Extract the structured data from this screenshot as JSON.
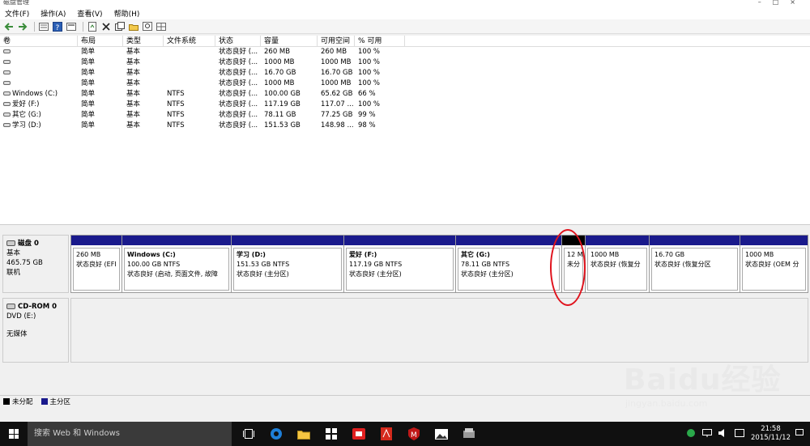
{
  "window": {
    "title": "磁盘管理"
  },
  "menu": [
    "文件(F)",
    "操作(A)",
    "查看(V)",
    "帮助(H)"
  ],
  "toolbar_icons": [
    "back-arrow-icon",
    "forward-arrow-icon",
    "list-icon",
    "help-icon",
    "properties-icon",
    "refresh-icon",
    "delete-icon",
    "copy-icon",
    "open-icon",
    "search-icon",
    "grid-icon"
  ],
  "volume_table": {
    "headers": [
      "卷",
      "布局",
      "类型",
      "文件系统",
      "状态",
      "容量",
      "可用空间",
      "% 可用"
    ],
    "rows": [
      [
        "",
        "简单",
        "基本",
        "",
        "状态良好 (...",
        "260 MB",
        "260 MB",
        "100 %"
      ],
      [
        "",
        "简单",
        "基本",
        "",
        "状态良好 (...",
        "1000 MB",
        "1000 MB",
        "100 %"
      ],
      [
        "",
        "简单",
        "基本",
        "",
        "状态良好 (...",
        "16.70 GB",
        "16.70 GB",
        "100 %"
      ],
      [
        "",
        "简单",
        "基本",
        "",
        "状态良好 (...",
        "1000 MB",
        "1000 MB",
        "100 %"
      ],
      [
        "Windows (C:)",
        "简单",
        "基本",
        "NTFS",
        "状态良好 (...",
        "100.00 GB",
        "65.62 GB",
        "66 %"
      ],
      [
        "爱好 (F:)",
        "简单",
        "基本",
        "NTFS",
        "状态良好 (...",
        "117.19 GB",
        "117.07 ...",
        "100 %"
      ],
      [
        "其它 (G:)",
        "简单",
        "基本",
        "NTFS",
        "状态良好 (...",
        "78.11 GB",
        "77.25 GB",
        "99 %"
      ],
      [
        "学习 (D:)",
        "简单",
        "基本",
        "NTFS",
        "状态良好 (...",
        "151.53 GB",
        "148.98 ...",
        "98 %"
      ]
    ]
  },
  "disk0": {
    "name": "磁盘 0",
    "type": "基本",
    "size": "465.75 GB",
    "status": "联机",
    "partitions": [
      {
        "name": "",
        "size": "260 MB",
        "status": "状态良好 (EFI",
        "kind": "primary"
      },
      {
        "name": "Windows  (C:)",
        "size": "100.00 GB NTFS",
        "status": "状态良好 (启动, 页面文件, 故障",
        "kind": "primary"
      },
      {
        "name": "学习  (D:)",
        "size": "151.53 GB NTFS",
        "status": "状态良好 (主分区)",
        "kind": "primary"
      },
      {
        "name": "爱好  (F:)",
        "size": "117.19 GB NTFS",
        "status": "状态良好 (主分区)",
        "kind": "primary"
      },
      {
        "name": "其它  (G:)",
        "size": "78.11 GB NTFS",
        "status": "状态良好 (主分区)",
        "kind": "primary"
      },
      {
        "name": "",
        "size": "12 M",
        "status": "未分",
        "kind": "unallocated"
      },
      {
        "name": "",
        "size": "1000 MB",
        "status": "状态良好 (恢复分",
        "kind": "primary"
      },
      {
        "name": "",
        "size": "16.70 GB",
        "status": "状态良好 (恢复分区",
        "kind": "primary"
      },
      {
        "name": "",
        "size": "1000 MB",
        "status": "状态良好 (OEM 分",
        "kind": "primary"
      }
    ]
  },
  "cdrom0": {
    "name": "CD-ROM 0",
    "type": "DVD (E:)",
    "status": "无媒体"
  },
  "legend": [
    {
      "label": "未分配",
      "color": "#000000"
    },
    {
      "label": "主分区",
      "color": "#1a1a8c"
    }
  ],
  "taskbar": {
    "search_placeholder": "搜索 Web 和 Windows",
    "apps": [
      "task-view-icon",
      "edge-icon",
      "file-explorer-icon",
      "store-icon",
      "app-red-icon",
      "app-acrobat-icon",
      "mcafee-icon",
      "photos-icon",
      "disk-manager-icon"
    ],
    "time": "21:58",
    "date": "2015/11/12"
  },
  "watermark": {
    "brand": "Baidu经验",
    "url": "jingyan.baidu.com"
  }
}
